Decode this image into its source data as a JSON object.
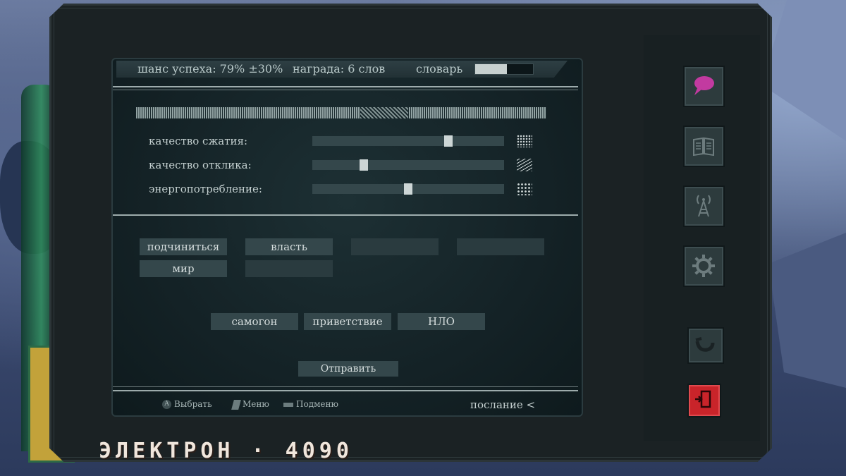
{
  "stats": {
    "chance": "шанс успеха: 79% ±30%",
    "reward": "награда: 6 слов",
    "dictionary_label": "словарь",
    "dictionary_fill": 0.55
  },
  "sliders": [
    {
      "label": "качество сжатия:",
      "value": 0.71,
      "pattern": "dots"
    },
    {
      "label": "качество отклика:",
      "value": 0.27,
      "pattern": "lines"
    },
    {
      "label": "энергопотребление:",
      "value": 0.5,
      "pattern": "triangles"
    }
  ],
  "words": {
    "row1": [
      "подчиниться",
      "власть",
      "",
      ""
    ],
    "row2": [
      "мир",
      ""
    ],
    "options": [
      "самогон",
      "приветствие",
      "НЛО"
    ]
  },
  "send_label": "Отправить",
  "hints": {
    "select": "Выбрать",
    "select_glyph": "A",
    "menu": "Меню",
    "submenu": "Подменю"
  },
  "mode": "послание <",
  "side_buttons": [
    "speech-bubble-icon",
    "book-icon",
    "radio-tower-icon",
    "gear-icon",
    "hook-icon",
    "exit-door-icon"
  ],
  "brand": "ЭЛЕКТРОН · 4090",
  "colors": {
    "accent_pink": "#c23aa0",
    "exit_red": "#c9242a"
  }
}
